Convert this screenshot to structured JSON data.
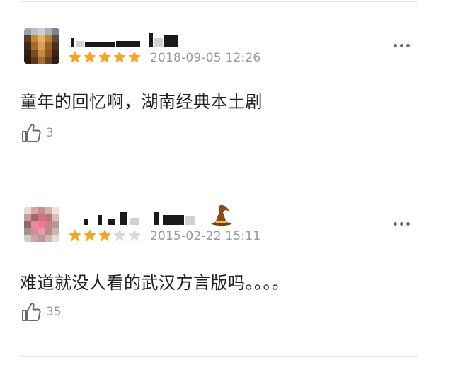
{
  "comments": [
    {
      "rating": 5,
      "max_rating": 5,
      "time": "2018-09-05 12:26",
      "text": "童年的回忆啊，湖南经典本土剧",
      "likes": "3",
      "more_icon": "more-dots-icon",
      "like_icon": "thumbs-up-icon"
    },
    {
      "rating": 3,
      "max_rating": 5,
      "time": "2015-02-22 15:11",
      "text": "难道就没人看的武汉方言版吗。。。。",
      "likes": "35",
      "more_icon": "more-dots-icon",
      "like_icon": "thumbs-up-icon",
      "badge_icon": "wizard-hat-icon"
    }
  ],
  "colors": {
    "star_active": "#f5a623",
    "star_inactive": "#d9d9d9",
    "meta_text": "#9a9a9a",
    "body_text": "#222222",
    "divider": "#e6e6e6",
    "hat": "#8b4a1c"
  }
}
